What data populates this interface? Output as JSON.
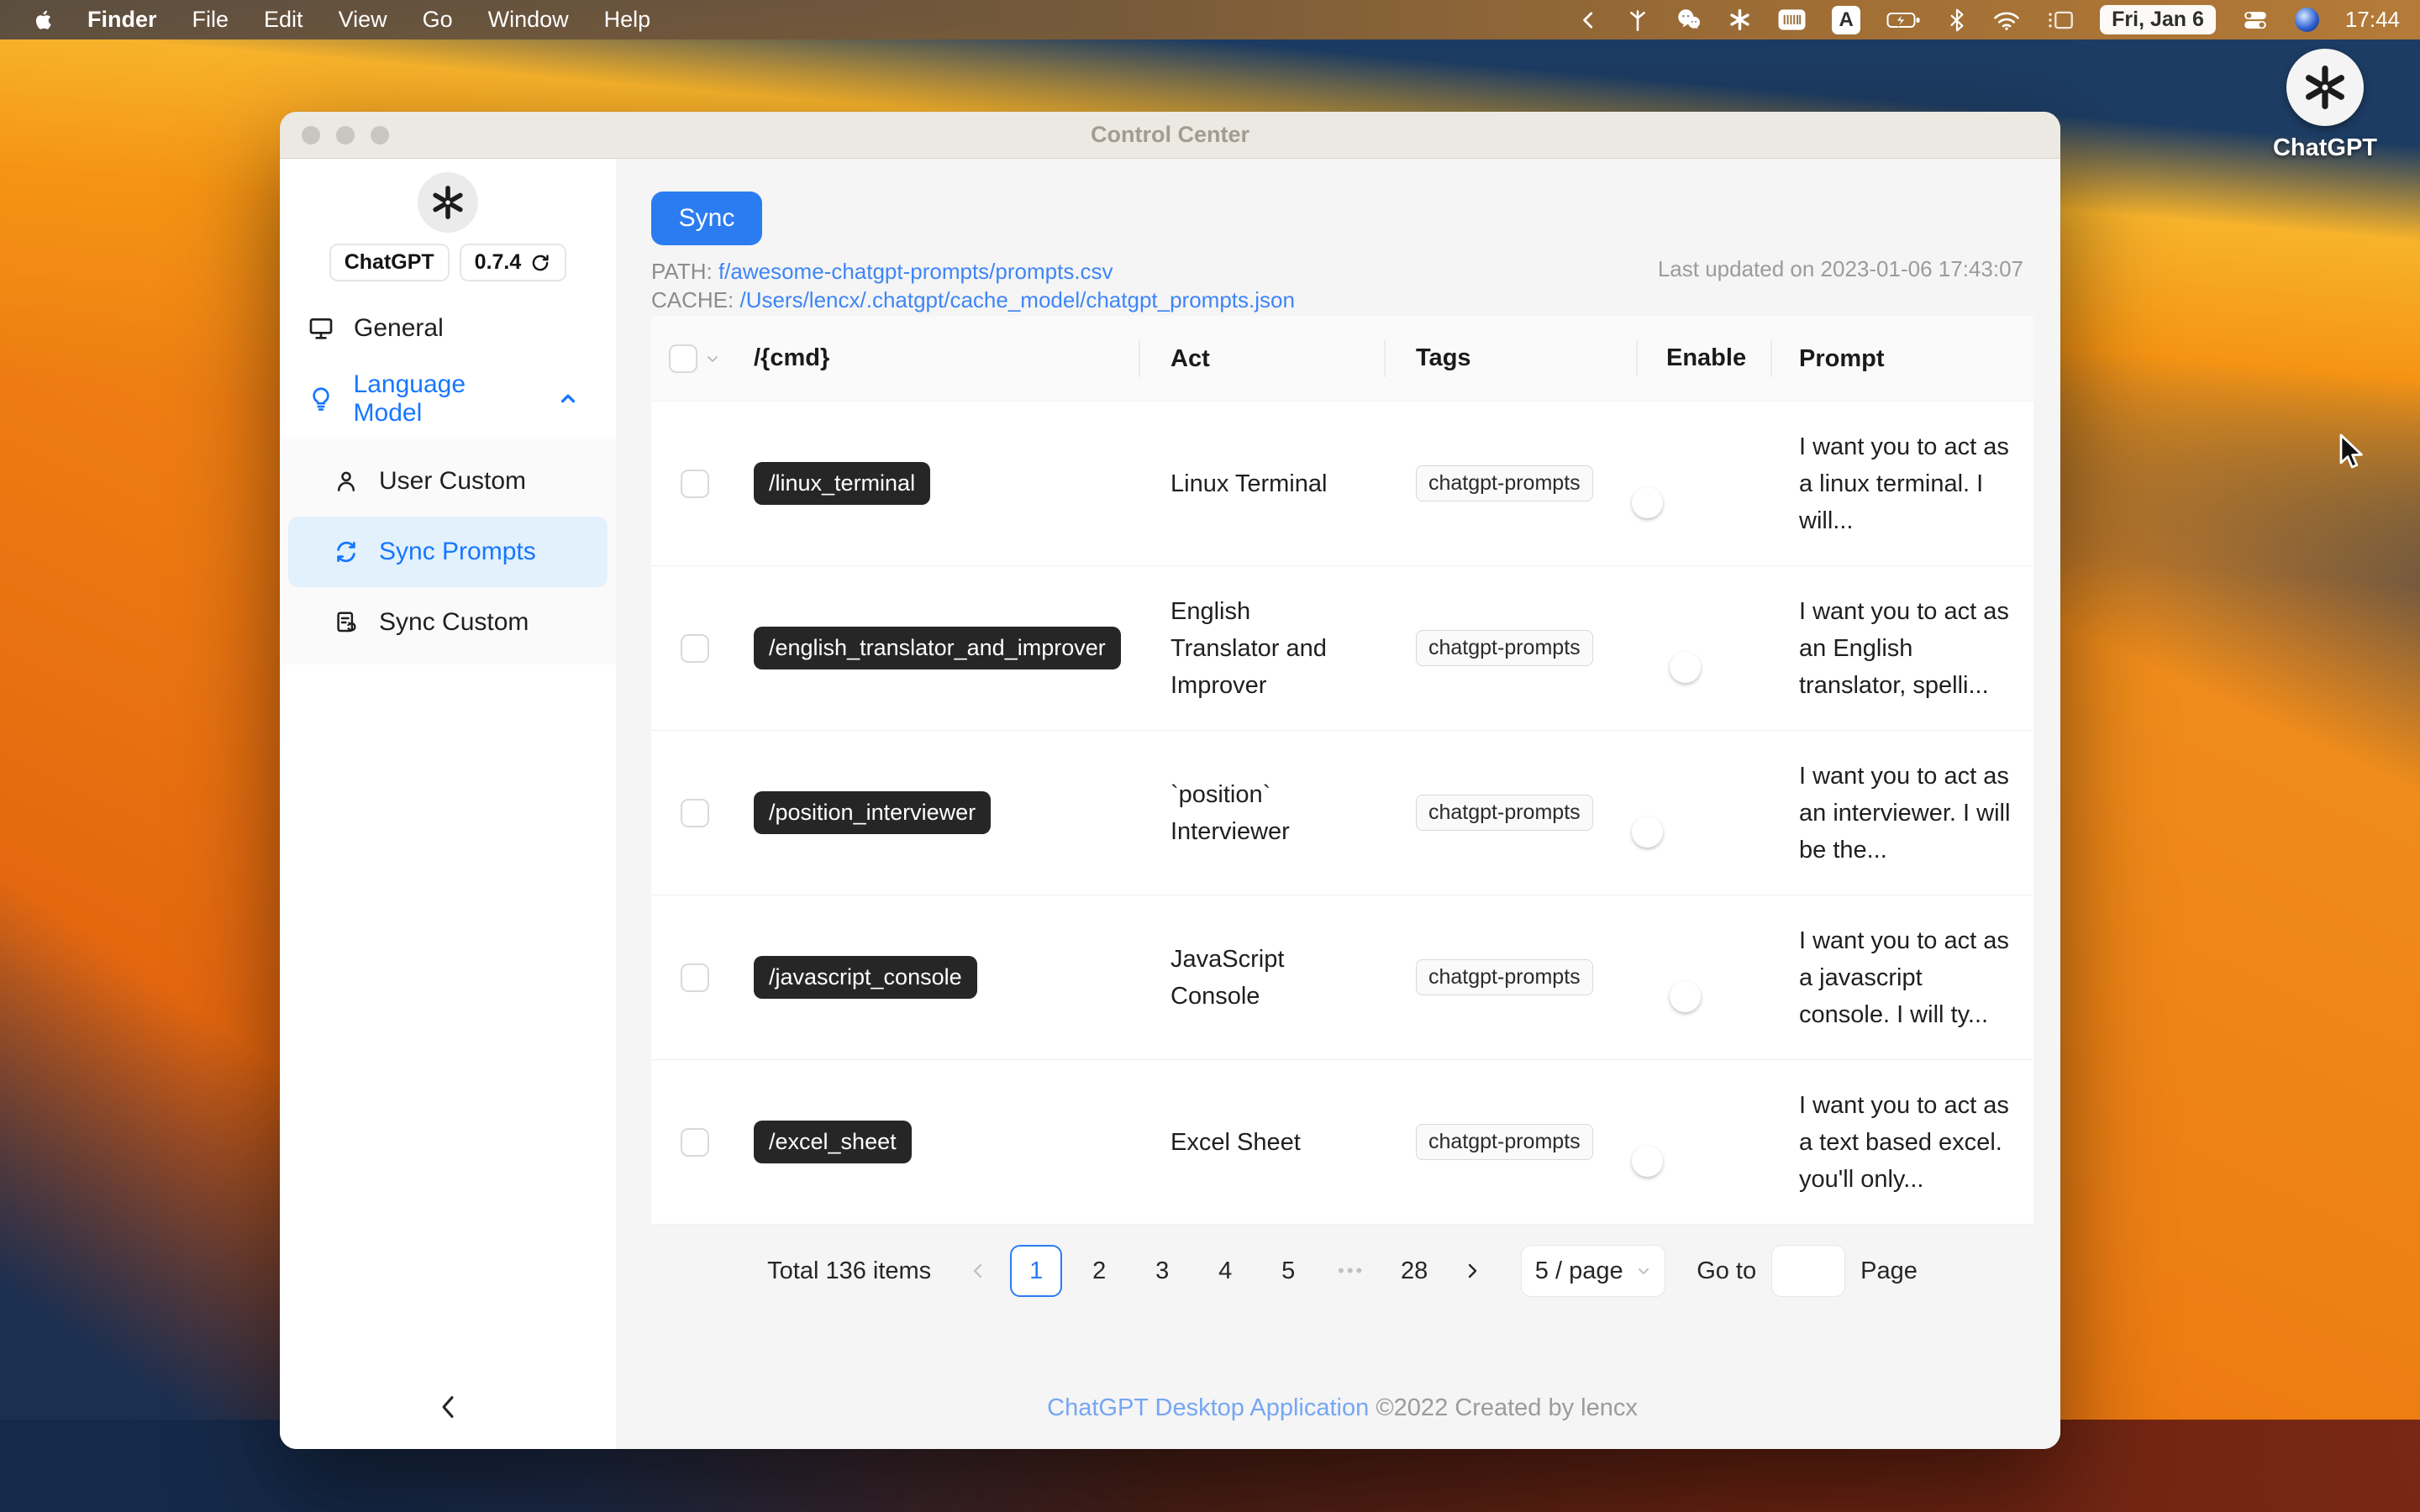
{
  "menu_bar": {
    "items": [
      "Finder",
      "File",
      "Edit",
      "View",
      "Go",
      "Window",
      "Help"
    ],
    "input_badge": "A",
    "date": "Fri, Jan 6",
    "time": "17:44",
    "status_icons": [
      "chevron-left",
      "fork",
      "wechat",
      "openai",
      "scanner",
      "input-source",
      "battery-charging",
      "bluetooth",
      "wifi",
      "screen-mirroring",
      "control-center",
      "globe"
    ]
  },
  "desktop": {
    "icon_label": "ChatGPT"
  },
  "window": {
    "title": "Control Center",
    "sidebar": {
      "app_name": "ChatGPT",
      "version": "0.7.4",
      "items": [
        {
          "label": "General"
        },
        {
          "label": "Language Model"
        },
        {
          "label": "User Custom"
        },
        {
          "label": "Sync Prompts"
        },
        {
          "label": "Sync Custom"
        }
      ]
    },
    "toolbar": {
      "sync_label": "Sync",
      "path_label": "PATH:",
      "path_value": "f/awesome-chatgpt-prompts/prompts.csv",
      "cache_label": "CACHE:",
      "cache_value": "/Users/lencx/.chatgpt/cache_model/chatgpt_prompts.json",
      "last_updated": "Last updated on 2023-01-06 17:43:07"
    },
    "table": {
      "headers": {
        "cmd": "/{cmd}",
        "act": "Act",
        "tags": "Tags",
        "enable": "Enable",
        "prompt": "Prompt"
      },
      "rows": [
        {
          "cmd": "/linux_terminal",
          "act": "Linux Terminal",
          "tag": "chatgpt-prompts",
          "enabled": true,
          "prompt": "I want you to act as a linux terminal. I will..."
        },
        {
          "cmd": "/english_translator_and_improver",
          "act": "English Translator and Improver",
          "tag": "chatgpt-prompts",
          "enabled": false,
          "prompt": "I want you to act as an English translator, spelli..."
        },
        {
          "cmd": "/position_interviewer",
          "act": "`position` Interviewer",
          "tag": "chatgpt-prompts",
          "enabled": true,
          "prompt": "I want you to act as an interviewer. I will be the..."
        },
        {
          "cmd": "/javascript_console",
          "act": "JavaScript Console",
          "tag": "chatgpt-prompts",
          "enabled": false,
          "prompt": "I want you to act as a javascript console. I will ty..."
        },
        {
          "cmd": "/excel_sheet",
          "act": "Excel Sheet",
          "tag": "chatgpt-prompts",
          "enabled": true,
          "prompt": "I want you to act as a text based excel. you'll only..."
        }
      ]
    },
    "pagination": {
      "total": "Total 136 items",
      "pages": [
        "1",
        "2",
        "3",
        "4",
        "5",
        "•••",
        "28"
      ],
      "active_page": "1",
      "page_size": "5 / page",
      "goto_label": "Go to",
      "goto_value": "",
      "page_label": "Page"
    },
    "footer": {
      "link_text": "ChatGPT Desktop Application",
      "copyright": "©2022 Created by lencx"
    }
  }
}
